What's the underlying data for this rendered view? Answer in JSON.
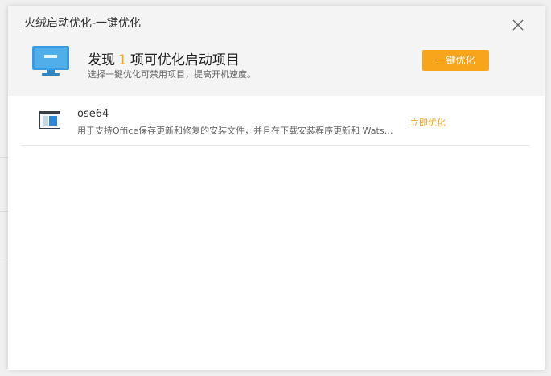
{
  "dialog": {
    "title": "火绒启动优化-一键优化",
    "headline_prefix": "发现",
    "headline_count": "1",
    "headline_suffix": "项可优化启动项目",
    "subtitle": "选择一键优化可禁用项目，提高开机速度。",
    "optimize_all_label": "一键优化"
  },
  "items": [
    {
      "name": "ose64",
      "description": "用于支持Office保存更新和修复的安装文件，并且在下载安装程序更新和 Watson 错误报告时使用。",
      "action_label": "立即优化",
      "icon": "window-app-icon"
    }
  ],
  "icons": {
    "close": "close-icon",
    "monitor": "monitor-icon"
  },
  "colors": {
    "accent": "#f8a51c",
    "monitor_blue": "#3a9be0"
  }
}
